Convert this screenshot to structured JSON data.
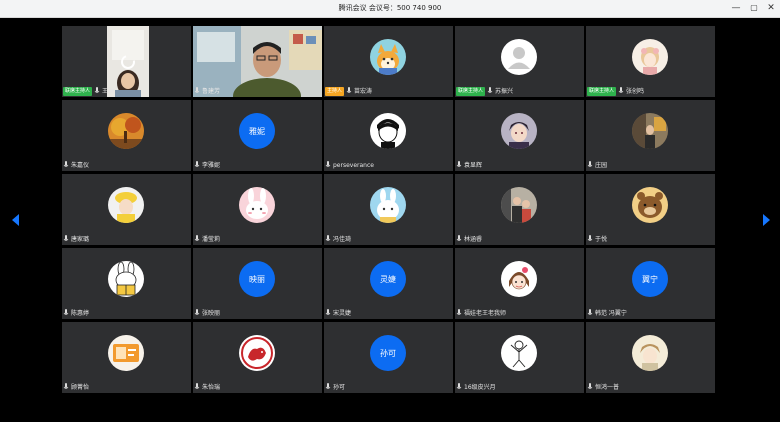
{
  "window": {
    "title": "腾讯会议  会议号：500 740 900",
    "controls": {
      "minimize": "—",
      "maximize": "▢",
      "close": "✕"
    }
  },
  "colors": {
    "tile_bg": "#2e2f31",
    "avatar_blue": "#0c6cf2",
    "cohost_badge": "#2fb24d",
    "host_badge": "#f5a623",
    "arrow": "#1677ff"
  },
  "participants": [
    {
      "name": "王琳",
      "badge": "联席主持人",
      "tile": "video-child"
    },
    {
      "name": "鲁建芳",
      "badge": "",
      "tile": "video-man"
    },
    {
      "name": "苗宏涛",
      "badge": "主持人",
      "avatar": "shiba-dog-cartoon"
    },
    {
      "name": "苏振兴",
      "badge": "联席主持人",
      "avatar": "default-person"
    },
    {
      "name": "张创鸣",
      "badge": "联席主持人",
      "avatar": "girl-illustration"
    },
    {
      "name": "朱嘉仪",
      "badge": "",
      "avatar": "autumn-tree-photo"
    },
    {
      "name": "李雅妮",
      "badge": "",
      "avatar_text": "雅妮"
    },
    {
      "name": "perseverance",
      "badge": "",
      "avatar": "boy-ink-drawing"
    },
    {
      "name": "袁显辉",
      "badge": "",
      "avatar": "anime-boy"
    },
    {
      "name": "庄园",
      "badge": "",
      "avatar": "street-photo"
    },
    {
      "name": "唐家璐",
      "badge": "",
      "avatar": "child-yellow-hat"
    },
    {
      "name": "潘莹莉",
      "badge": "",
      "avatar": "pink-rabbit-cartoon"
    },
    {
      "name": "冯佳琦",
      "badge": "",
      "avatar": "rabbit-cartoon"
    },
    {
      "name": "林涵睿",
      "badge": "",
      "avatar": "family-photo"
    },
    {
      "name": "于悦",
      "badge": "",
      "avatar": "brown-bear-cartoon"
    },
    {
      "name": "陈惠婷",
      "badge": "",
      "avatar": "rabbit-reading-cartoon"
    },
    {
      "name": "张映丽",
      "badge": "",
      "avatar_text": "映丽"
    },
    {
      "name": "宋灵婕",
      "badge": "",
      "avatar_text": "灵婕"
    },
    {
      "name": "福娃老王老我师",
      "badge": "",
      "avatar": "cartoon-girl"
    },
    {
      "name": "韩范 冯翼宁",
      "badge": "",
      "avatar_text": "翼宁"
    },
    {
      "name": "顾菁怡",
      "badge": "",
      "avatar": "orange-card"
    },
    {
      "name": "朱怡瑞",
      "badge": "",
      "avatar": "red-paper-cut"
    },
    {
      "name": "孙可",
      "badge": "",
      "avatar_text": "孙可"
    },
    {
      "name": "16级皮兴月",
      "badge": "",
      "avatar": "line-art-figure"
    },
    {
      "name": "恒鸿一普",
      "badge": "",
      "avatar": "cream-illustration"
    }
  ],
  "nav": {
    "prev_icon": "chevron-left-icon",
    "next_icon": "chevron-right-icon"
  }
}
